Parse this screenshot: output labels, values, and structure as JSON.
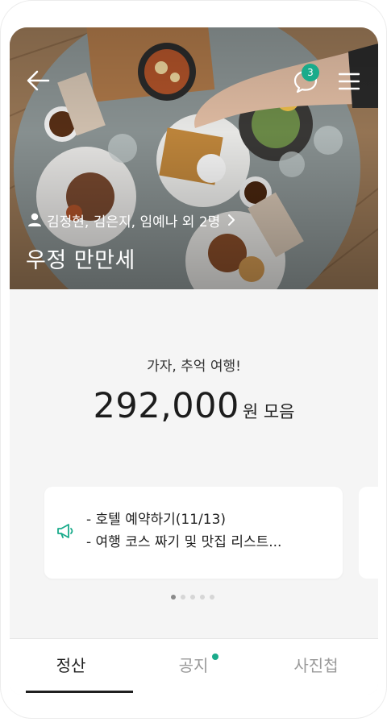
{
  "header": {
    "chat_badge_count": "3",
    "members_text": "김정현, 김은지, 임예나 외 2명",
    "group_title": "우정 만만세"
  },
  "summary": {
    "slogan": "가자, 추억 여행!",
    "amount": "292,000",
    "unit": "원 모음"
  },
  "notice": {
    "lines": [
      "- 호텔 예약하기(11/13)",
      "- 여행 코스 짜기 및 맛집 리스트..."
    ]
  },
  "pager": {
    "count": 5,
    "active": 1
  },
  "tabs": [
    {
      "label": "정산",
      "active": true
    },
    {
      "label": "공지",
      "active": false,
      "has_new": true
    },
    {
      "label": "사진첩",
      "active": false
    }
  ],
  "colors": {
    "accent": "#1aab8b",
    "background": "#f5f5f5"
  },
  "icons": [
    "back-arrow-icon",
    "chat-bubble-icon",
    "menu-icon",
    "person-icon",
    "chevron-right-icon",
    "megaphone-icon"
  ]
}
